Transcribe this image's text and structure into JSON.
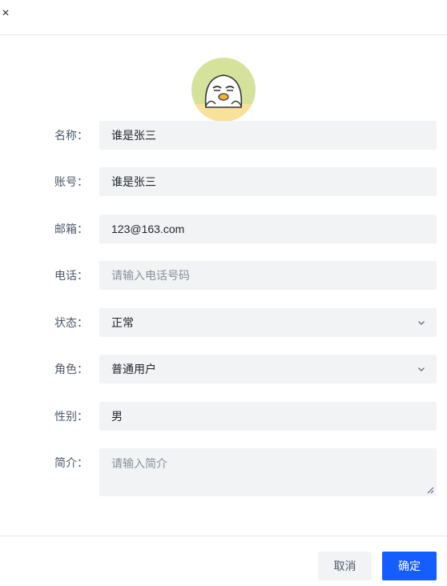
{
  "dialog": {
    "close_glyph": "×"
  },
  "form": {
    "name": {
      "label": "名称：",
      "value": "谁是张三"
    },
    "account": {
      "label": "账号：",
      "value": "谁是张三"
    },
    "email": {
      "label": "邮箱：",
      "value": "123@163.com"
    },
    "phone": {
      "label": "电话：",
      "value": "",
      "placeholder": "请输入电话号码"
    },
    "status": {
      "label": "状态：",
      "value": "正常"
    },
    "role": {
      "label": "角色：",
      "value": "普通用户"
    },
    "gender": {
      "label": "性别：",
      "value": "男"
    },
    "intro": {
      "label": "简介：",
      "value": "",
      "placeholder": "请输入简介"
    }
  },
  "footer": {
    "cancel_label": "取消",
    "confirm_label": "确定"
  },
  "colors": {
    "primary": "#165dff",
    "field_bg": "#f2f3f5",
    "label": "#4e5969",
    "placeholder": "#86909c"
  }
}
